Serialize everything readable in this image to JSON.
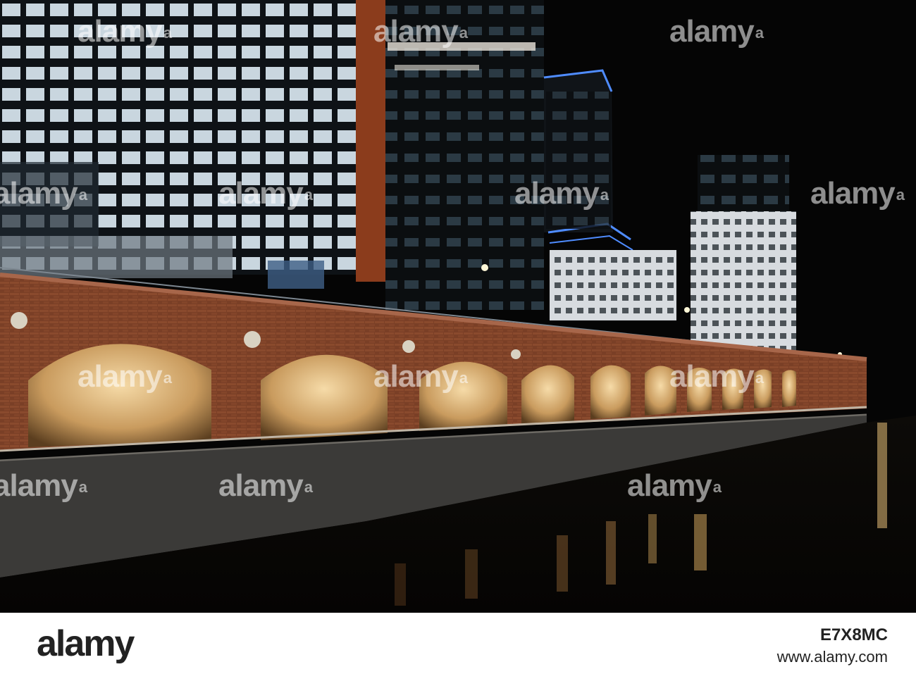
{
  "watermark": {
    "text": "alamy",
    "symbol": "a"
  },
  "footer": {
    "logo": "alamy",
    "image_id": "E7X8MC",
    "url": "www.alamy.com"
  }
}
